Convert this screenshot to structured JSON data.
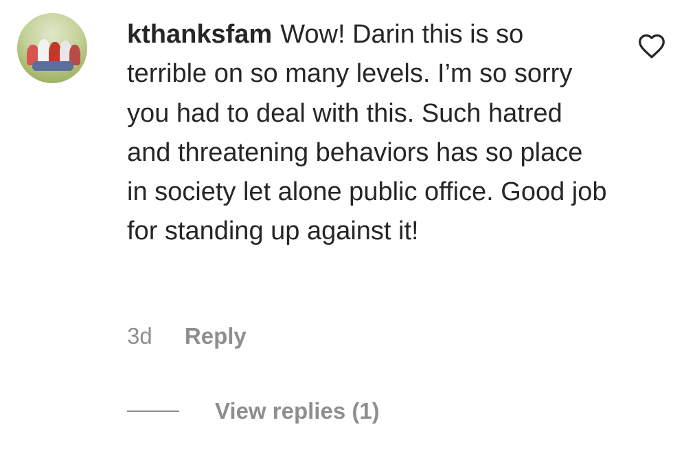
{
  "comment": {
    "username": "kthanksfam",
    "text": "Wow! Darin this is so terrible on so many levels. I’m so sorry you had to deal with this. Such hatred and threatening behaviors has so place in society let alone public office. Good job for standing up against it!",
    "time": "3d",
    "reply_label": "Reply",
    "view_replies_label": "View replies (1)",
    "icons": {
      "avatar": "profile-photo",
      "like": "heart-outline-icon"
    }
  },
  "colors": {
    "text": "#262626",
    "muted": "#8e8e8e",
    "background": "#ffffff"
  }
}
